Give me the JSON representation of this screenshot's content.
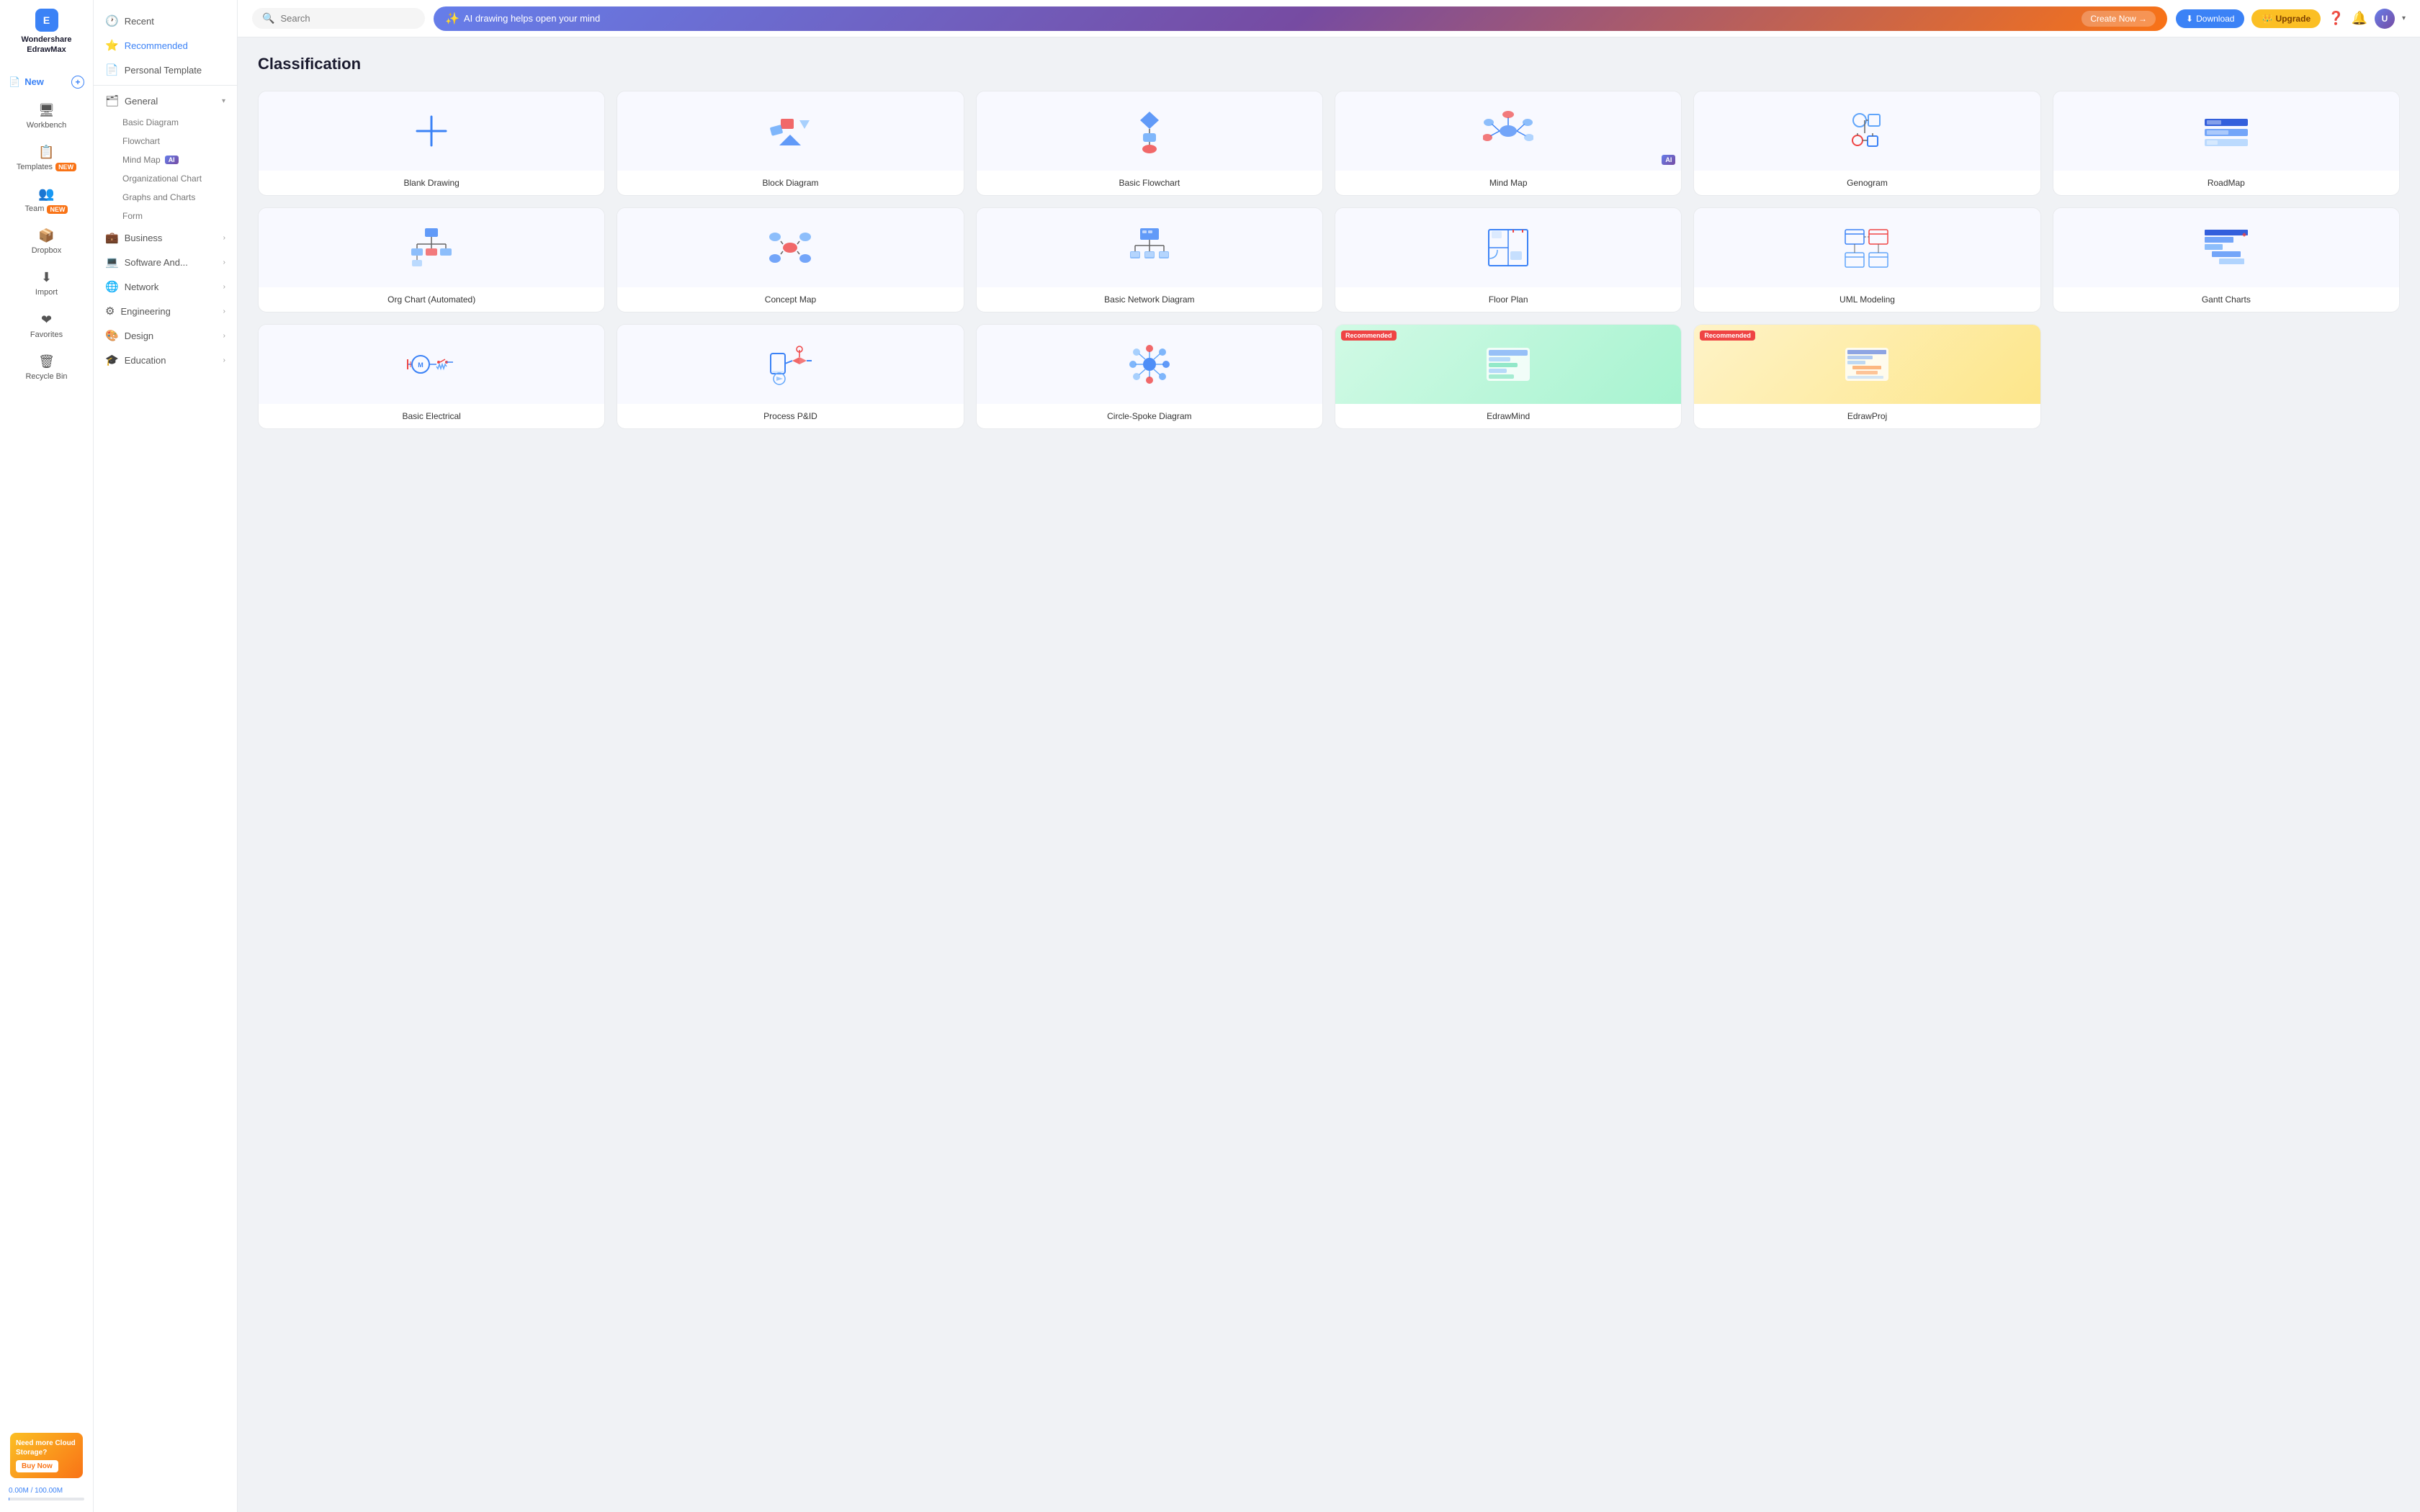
{
  "app": {
    "name": "Wondershare",
    "name2": "EdrawMax",
    "logo_letter": "E"
  },
  "header": {
    "search_placeholder": "Search",
    "ai_banner_text": "AI drawing helps open your mind",
    "ai_banner_btn": "Create Now →",
    "btn_download": "Download",
    "btn_upgrade": "Upgrade"
  },
  "left_nav": {
    "items": [
      {
        "id": "new",
        "label": "New",
        "icon": "📄",
        "badge": "",
        "has_plus": true
      },
      {
        "id": "workbench",
        "label": "Workbench",
        "icon": "🖥",
        "badge": ""
      },
      {
        "id": "templates",
        "label": "Templates",
        "icon": "📋",
        "badge": "NEW"
      },
      {
        "id": "team",
        "label": "Team",
        "icon": "👥",
        "badge": "NEW"
      },
      {
        "id": "dropbox",
        "label": "Dropbox",
        "icon": "📦",
        "badge": ""
      },
      {
        "id": "import",
        "label": "Import",
        "icon": "⬇",
        "badge": ""
      },
      {
        "id": "favorites",
        "label": "Favorites",
        "icon": "❤",
        "badge": ""
      },
      {
        "id": "recycle",
        "label": "Recycle Bin",
        "icon": "🗑",
        "badge": ""
      }
    ]
  },
  "cloud_promo": {
    "title": "Need more Cloud Storage?",
    "btn": "Buy Now"
  },
  "storage": {
    "used": "0.00M",
    "total": "100.00M",
    "text": "0.00M / 100.00M"
  },
  "category_nav": {
    "items": [
      {
        "id": "recent",
        "label": "Recent",
        "icon": "🕐",
        "active": false,
        "expandable": false
      },
      {
        "id": "recommended",
        "label": "Recommended",
        "icon": "⭐",
        "active": true,
        "expandable": false
      },
      {
        "id": "personal",
        "label": "Personal Template",
        "icon": "📄",
        "active": false,
        "expandable": false
      },
      {
        "id": "general",
        "label": "General",
        "icon": "🗂",
        "active": false,
        "expandable": true,
        "expanded": true,
        "subitems": [
          "Basic Diagram",
          "Flowchart",
          "Mind Map",
          "Organizational Chart",
          "Graphs and Charts",
          "Form"
        ]
      },
      {
        "id": "business",
        "label": "Business",
        "icon": "💼",
        "active": false,
        "expandable": true
      },
      {
        "id": "software",
        "label": "Software And...",
        "icon": "💻",
        "active": false,
        "expandable": true
      },
      {
        "id": "network",
        "label": "Network",
        "icon": "🌐",
        "active": false,
        "expandable": true
      },
      {
        "id": "engineering",
        "label": "Engineering",
        "icon": "⚙",
        "active": false,
        "expandable": true
      },
      {
        "id": "design",
        "label": "Design",
        "icon": "🎨",
        "active": false,
        "expandable": true
      },
      {
        "id": "education",
        "label": "Education",
        "icon": "🎓",
        "active": false,
        "expandable": true
      }
    ]
  },
  "main": {
    "title": "Classification",
    "templates": [
      {
        "id": "blank",
        "label": "Blank Drawing",
        "type": "blank",
        "recommended": false,
        "ai": false
      },
      {
        "id": "block",
        "label": "Block Diagram",
        "type": "block",
        "recommended": false,
        "ai": false
      },
      {
        "id": "flowchart",
        "label": "Basic Flowchart",
        "type": "flowchart",
        "recommended": false,
        "ai": false
      },
      {
        "id": "mindmap",
        "label": "Mind Map",
        "type": "mindmap",
        "recommended": false,
        "ai": true
      },
      {
        "id": "genogram",
        "label": "Genogram",
        "type": "genogram",
        "recommended": false,
        "ai": false
      },
      {
        "id": "roadmap",
        "label": "RoadMap",
        "type": "roadmap",
        "recommended": false,
        "ai": false
      },
      {
        "id": "orgchart",
        "label": "Org Chart (Automated)",
        "type": "orgchart",
        "recommended": false,
        "ai": false
      },
      {
        "id": "concept",
        "label": "Concept Map",
        "type": "concept",
        "recommended": false,
        "ai": false
      },
      {
        "id": "network",
        "label": "Basic Network Diagram",
        "type": "network",
        "recommended": false,
        "ai": false
      },
      {
        "id": "floorplan",
        "label": "Floor Plan",
        "type": "floorplan",
        "recommended": false,
        "ai": false
      },
      {
        "id": "uml",
        "label": "UML Modeling",
        "type": "uml",
        "recommended": false,
        "ai": false
      },
      {
        "id": "gantt",
        "label": "Gantt Charts",
        "type": "gantt",
        "recommended": false,
        "ai": false
      },
      {
        "id": "electrical",
        "label": "Basic Electrical",
        "type": "electrical",
        "recommended": false,
        "ai": false
      },
      {
        "id": "pid",
        "label": "Process P&ID",
        "type": "pid",
        "recommended": false,
        "ai": false
      },
      {
        "id": "circle",
        "label": "Circle-Spoke Diagram",
        "type": "circle",
        "recommended": false,
        "ai": false
      },
      {
        "id": "edrawmind",
        "label": "EdrawMind",
        "type": "edrawmind",
        "recommended": true,
        "ai": false
      },
      {
        "id": "edrawproj",
        "label": "EdrawProj",
        "type": "edrawproj",
        "recommended": true,
        "ai": false
      }
    ]
  }
}
